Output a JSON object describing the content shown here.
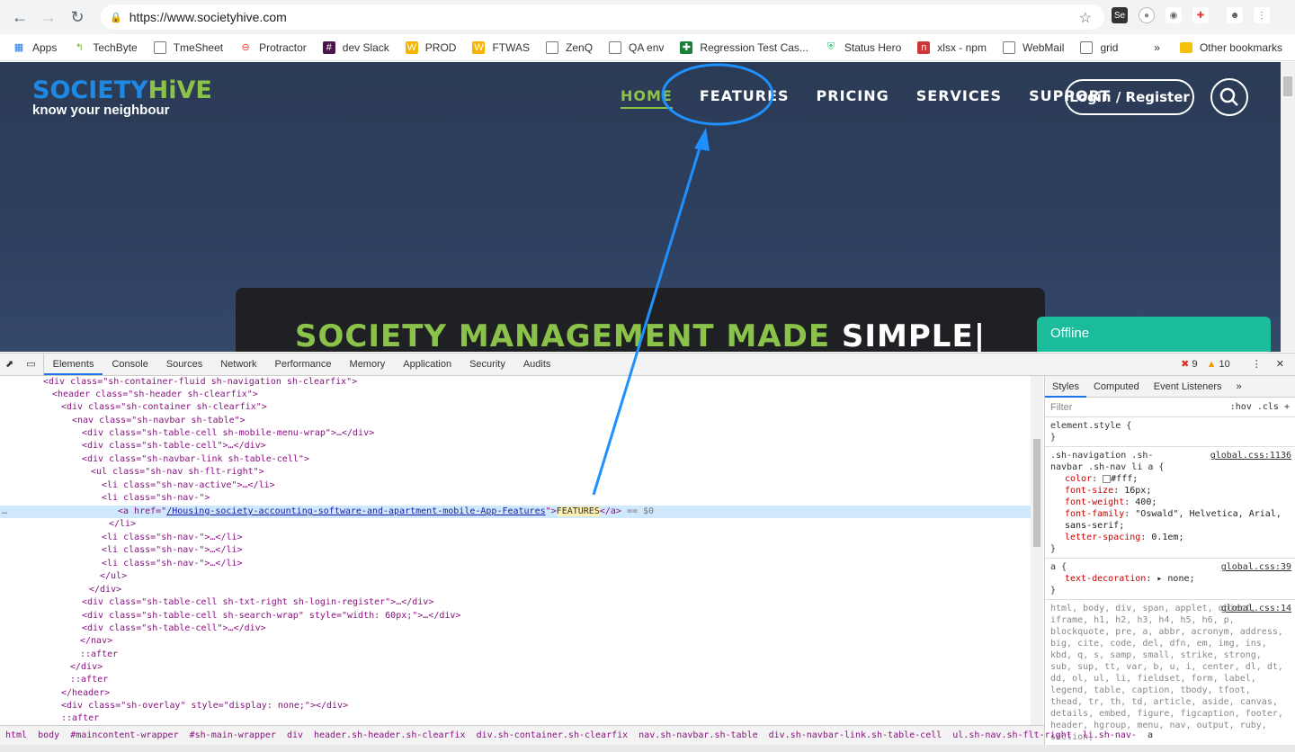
{
  "browser": {
    "url": "https://www.societyhive.com",
    "bookmarks": [
      "Apps",
      "TechByte",
      "TmeSheet",
      "Protractor",
      "dev Slack",
      "PROD",
      "FTWAS",
      "ZenQ",
      "QA env",
      "Regression Test Cas...",
      "Status Hero",
      "xlsx - npm",
      "WebMail",
      "grid"
    ],
    "other_bookmarks": "Other bookmarks",
    "more": "»"
  },
  "site": {
    "logo_part1": "SOCIETY",
    "logo_part2": "HiVE",
    "tagline": "know your neighbour",
    "nav": [
      "HOME",
      "FEATURES",
      "PRICING",
      "SERVICES",
      "SUPPORT"
    ],
    "login": "Login / Register",
    "hero_green": "SOCIETY MANAGEMENT MADE",
    "hero_white": "SIMPLE",
    "chat_status": "Offline"
  },
  "devtools": {
    "tabs": [
      "Elements",
      "Console",
      "Sources",
      "Network",
      "Performance",
      "Memory",
      "Application",
      "Security",
      "Audits"
    ],
    "errors": "9",
    "warnings": "10",
    "dom": {
      "l1": "<div class=\"sh-container-fluid sh-navigation sh-clearfix\">",
      "l2": "<header class=\"sh-header sh-clearfix\">",
      "l3": "<div class=\"sh-container sh-clearfix\">",
      "l4": "<nav class=\"sh-navbar sh-table\">",
      "l5": "<div class=\"sh-table-cell sh-mobile-menu-wrap\">…</div>",
      "l6": "<div class=\"sh-table-cell\">…</div>",
      "l7": "<div class=\"sh-navbar-link sh-table-cell\">",
      "l8": "<ul class=\"sh-nav sh-flt-right\">",
      "l9": "<li class=\"sh-nav-active\">…</li>",
      "l10": "<li class=\"sh-nav-\">",
      "l11_pre": "<a href=\"",
      "l11_href": "/Housing-society-accounting-software-and-apartment-mobile-App-Features",
      "l11_mid": "\">",
      "l11_text": "FEATURES",
      "l11_post": "</a>",
      "l11_eq": " == $0",
      "l12": "</li>",
      "l13": "<li class=\"sh-nav-\">…</li>",
      "l14": "<li class=\"sh-nav-\">…</li>",
      "l15": "<li class=\"sh-nav-\">…</li>",
      "l16": "</ul>",
      "l17": "</div>",
      "l18": "<div class=\"sh-table-cell sh-txt-right sh-login-register\">…</div>",
      "l19": "<div class=\"sh-table-cell sh-search-wrap\" style=\"width: 60px;\">…</div>",
      "l20": "<div class=\"sh-table-cell\">…</div>",
      "l21": "</nav>",
      "l22": "::after",
      "l23": "</div>",
      "l24": "::after",
      "l25": "</header>",
      "l26": "<div class=\"sh-overlay\" style=\"display: none;\"></div>",
      "l27": "::after"
    },
    "styles": {
      "tabs": [
        "Styles",
        "Computed",
        "Event Listeners",
        "»"
      ],
      "filter_placeholder": "Filter",
      "filter_right": ":hov .cls +",
      "element_style": "element.style {",
      "close": "}",
      "rule1_selector": ".sh-navigation .sh-navbar .sh-nav li a {",
      "rule1_src": "global.css:1136",
      "rule1_props": [
        {
          "n": "color",
          "v": "#fff;"
        },
        {
          "n": "font-size",
          "v": "16px;"
        },
        {
          "n": "font-weight",
          "v": "400;"
        },
        {
          "n": "font-family",
          "v": "\"Oswald\", Helvetica, Arial, sans-serif;"
        },
        {
          "n": "letter-spacing",
          "v": "0.1em;"
        }
      ],
      "rule2_selector": "a {",
      "rule2_src": "global.css:39",
      "rule2_prop": {
        "n": "text-decoration",
        "v": "▸ none;"
      },
      "rule3_src": "global.css:14",
      "rule3_text": "html, body, div, span, applet, object, iframe, h1, h2, h3, h4, h5, h6, p, blockquote, pre, a, abbr, acronym, address, big, cite, code, del, dfn, em, img, ins, kbd, q, s, samp, small, strike, strong, sub, sup, tt, var, b, u, i, center, dl, dt, dd, ol, ul, li, fieldset, form, label, legend, table, caption, tbody, tfoot, thead, tr, th, td, article, aside, canvas, details, embed, figure, figcaption, footer, header, hgroup, menu, nav, output, ruby, section,"
    },
    "breadcrumbs": [
      "html",
      "body",
      "#maincontent-wrapper",
      "#sh-main-wrapper",
      "div",
      "header.sh-header.sh-clearfix",
      "div.sh-container.sh-clearfix",
      "nav.sh-navbar.sh-table",
      "div.sh-navbar-link.sh-table-cell",
      "ul.sh-nav.sh-flt-right",
      "li.sh-nav-",
      "a"
    ]
  },
  "colors": {
    "accent_green": "#8bc34a",
    "logo_blue": "#1e88e5",
    "annotation_blue": "#1e90ff",
    "chat_green": "#1abc9c"
  }
}
